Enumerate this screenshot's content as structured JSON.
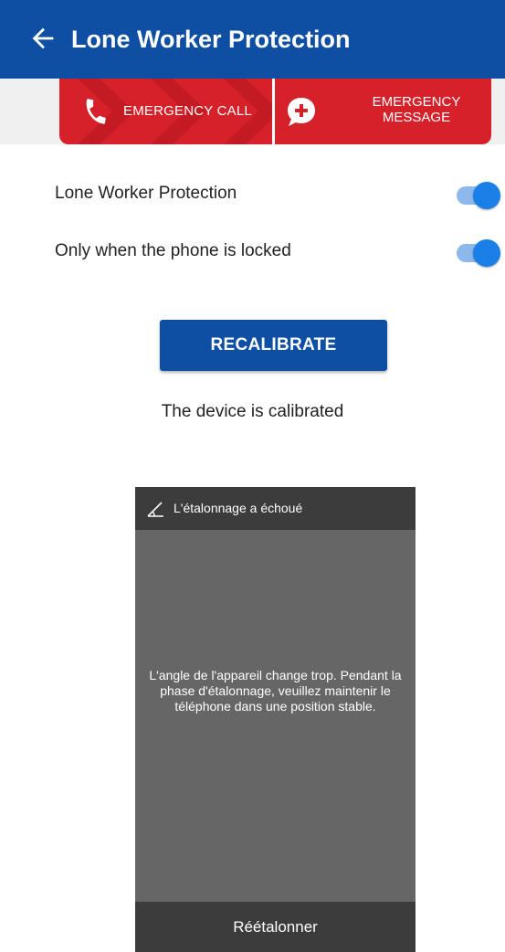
{
  "appbar": {
    "title": "Lone Worker Protection",
    "back_icon": "arrow-left-icon",
    "color": "#0e4ea3"
  },
  "emergency": {
    "call_label": "EMERGENCY CALL",
    "call_icon": "phone-icon",
    "message_line1": "EMERGENCY",
    "message_line2": "MESSAGE",
    "message_icon": "chat-plus-icon",
    "color": "#d6202a"
  },
  "settings": [
    {
      "label": "Lone Worker Protection",
      "enabled": true
    },
    {
      "label": "Only when the phone is locked",
      "enabled": true
    }
  ],
  "recalibrate_label": "RECALIBRATE",
  "calibration_status": "The device is calibrated",
  "dialog": {
    "title": "L'étalonnage a échoué",
    "title_icon": "angle-icon",
    "message": "L'angle de l'appareil change trop. Pendant la phase d'étalonnage, veuillez maintenir le téléphone dans une position stable.",
    "action_label": "Réétalonner"
  }
}
